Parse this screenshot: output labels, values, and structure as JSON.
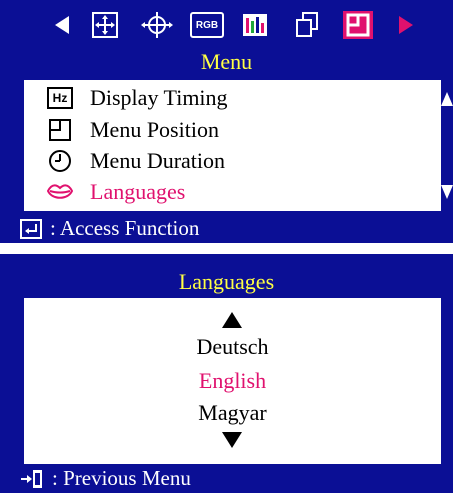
{
  "top_panel": {
    "title": "Menu",
    "icon_bar": [
      "left-arrow-icon",
      "move-icon",
      "position-icon",
      "rgb-icon",
      "color-bars-icon",
      "copy-icon",
      "menu-position-icon",
      "right-arrow-icon"
    ],
    "rgb_icon_text": "RGB",
    "menu_items": [
      {
        "label": "Display Timing",
        "icon": "hz-icon",
        "icon_text": "Hz"
      },
      {
        "label": "Menu Position",
        "icon": "menu-position-icon"
      },
      {
        "label": "Menu Duration",
        "icon": "clock-icon"
      },
      {
        "label": "Languages",
        "icon": "lips-icon",
        "selected": true
      }
    ],
    "footer_text": ": Access Function"
  },
  "bottom_panel": {
    "title": "Languages",
    "options": [
      {
        "label": "Deutsch"
      },
      {
        "label": "English",
        "selected": true
      },
      {
        "label": "Magyar"
      }
    ],
    "footer_text": ": Previous Menu"
  },
  "colors": {
    "panel_bg": "#0b0f95",
    "title": "#ffff44",
    "highlight": "#e0116e",
    "text": "#000000"
  }
}
